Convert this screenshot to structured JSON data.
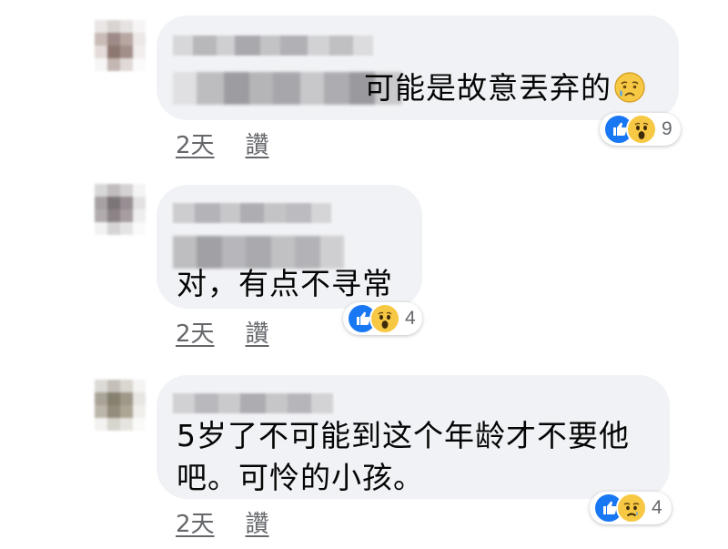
{
  "comments": [
    {
      "text_lines": [
        "可能是故意丟弃的"
      ],
      "reactions": {
        "icons": [
          "like-icon",
          "wow-icon"
        ],
        "count": "9"
      },
      "time": "2天",
      "like_label": "讚"
    },
    {
      "text_lines": [
        "对，有点不寻常"
      ],
      "reactions": {
        "icons": [
          "like-icon",
          "wow-icon"
        ],
        "count": "4"
      },
      "time": "2天",
      "like_label": "讚"
    },
    {
      "text_lines": [
        "5岁了不可能到这个年龄才不要他",
        "吧。可怜的小孩。"
      ],
      "reactions": {
        "icons": [
          "like-icon",
          "sad-icon"
        ],
        "count": "4"
      },
      "time": "2天",
      "like_label": "讚"
    }
  ],
  "colors": {
    "bubble": "#f0f2f5",
    "meta_text": "#65676b",
    "like_blue": "#1877f2",
    "emoji_yellow": "#f7c843"
  }
}
